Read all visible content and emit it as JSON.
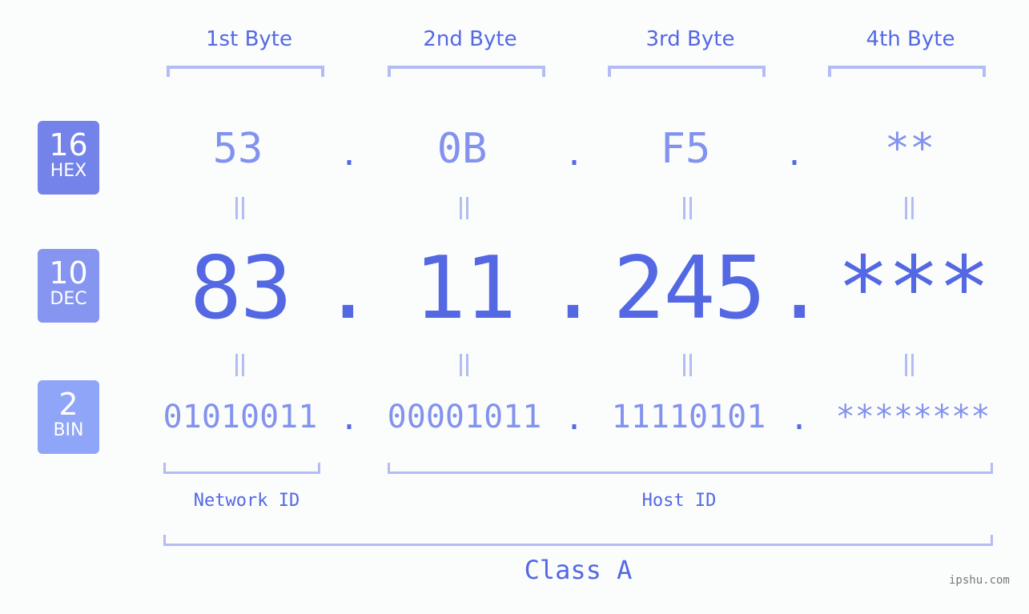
{
  "byte_headers": [
    "1st Byte",
    "2nd Byte",
    "3rd Byte",
    "4th Byte"
  ],
  "rows": {
    "hex": {
      "base": "16",
      "unit": "HEX",
      "values": [
        "53",
        "0B",
        "F5",
        "**"
      ],
      "badge_color": "#7483ea"
    },
    "dec": {
      "base": "10",
      "unit": "DEC",
      "values": [
        "83",
        "11",
        "245",
        "***"
      ],
      "badge_color": "#8595f0"
    },
    "bin": {
      "base": "2",
      "unit": "BIN",
      "values": [
        "01010011",
        "00001011",
        "11110101",
        "********"
      ],
      "badge_color": "#8fa6f8"
    }
  },
  "separator": ".",
  "segments": {
    "network": "Network ID",
    "host": "Host ID",
    "class": "Class A"
  },
  "watermark": "ipshu.com",
  "colors": {
    "accent": "#5468e4",
    "muted": "#8392ee",
    "bracket": "#b3bcf4",
    "background": "#fbfdfc"
  }
}
